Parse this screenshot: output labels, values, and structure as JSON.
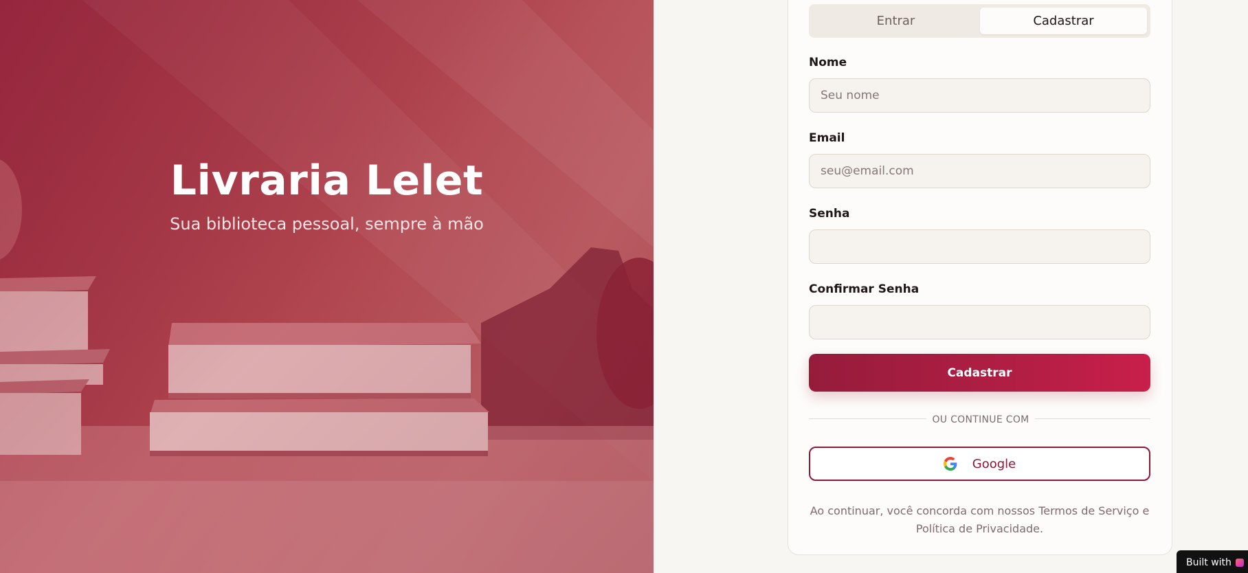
{
  "hero": {
    "title": "Livraria Lelet",
    "subtitle": "Sua biblioteca pessoal, sempre à mão"
  },
  "tabs": [
    {
      "label": "Entrar",
      "active": false
    },
    {
      "label": "Cadastrar",
      "active": true
    }
  ],
  "form": {
    "name": {
      "label": "Nome",
      "placeholder": "Seu nome",
      "value": ""
    },
    "email": {
      "label": "Email",
      "placeholder": "seu@email.com",
      "value": ""
    },
    "password": {
      "label": "Senha",
      "placeholder": "",
      "value": ""
    },
    "confirm_password": {
      "label": "Confirmar Senha",
      "placeholder": "",
      "value": ""
    },
    "submit_label": "Cadastrar"
  },
  "divider": {
    "text": "OU CONTINUE COM"
  },
  "google": {
    "label": "Google",
    "icon": "google-icon"
  },
  "legal": {
    "text": "Ao continuar, você concorda com nossos Termos de Serviço e Política de Privacidade."
  },
  "badge": {
    "text": "Built with"
  },
  "colors": {
    "primary": "#961c3c",
    "primary_end": "#c91f4a",
    "background": "#f8f6f2",
    "card": "#fdfcfa"
  }
}
